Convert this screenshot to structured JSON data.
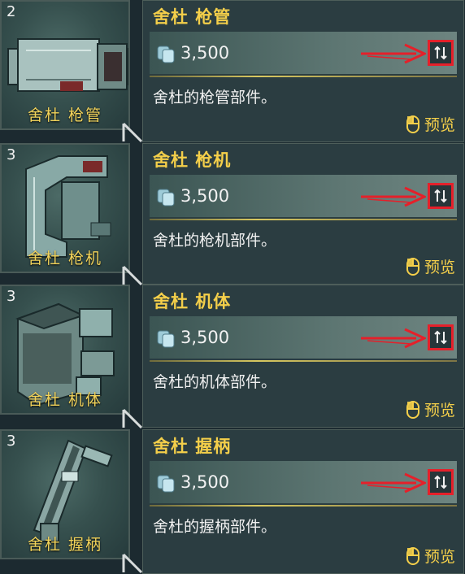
{
  "items": [
    {
      "count": "2",
      "thumb_label": "舍杜  枪管",
      "title": "舍杜 枪管",
      "price": "3,500",
      "description": "舍杜的枪管部件。",
      "preview_label": "预览"
    },
    {
      "count": "3",
      "thumb_label": "舍杜  枪机",
      "title": "舍杜 枪机",
      "price": "3,500",
      "description": "舍杜的枪机部件。",
      "preview_label": "预览"
    },
    {
      "count": "3",
      "thumb_label": "舍杜  机体",
      "title": "舍杜 机体",
      "price": "3,500",
      "description": "舍杜的机体部件。",
      "preview_label": "预览"
    },
    {
      "count": "3",
      "thumb_label": "舍杜  握柄",
      "title": "舍杜 握柄",
      "price": "3,500",
      "description": "舍杜的握柄部件。",
      "preview_label": "预览"
    }
  ],
  "colors": {
    "accent": "#f4cf4a",
    "highlight": "#e5202a",
    "panel": "#2b3d41"
  },
  "icons": {
    "currency": "coin-stack-icon",
    "swap": "swap-icon",
    "preview": "mouse-icon",
    "annotation": "red-arrow-icon"
  }
}
